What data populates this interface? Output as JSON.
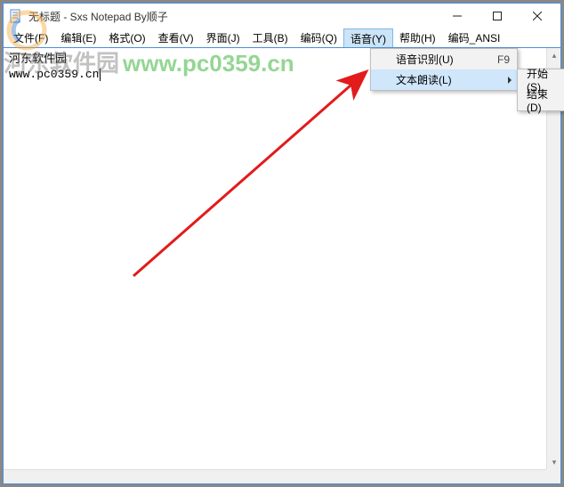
{
  "window": {
    "title": "无标题 - Sxs Notepad  By顺子"
  },
  "menubar": {
    "items": [
      "文件(F)",
      "编辑(E)",
      "格式(O)",
      "查看(V)",
      "界面(J)",
      "工具(B)",
      "编码(Q)",
      "语音(Y)",
      "帮助(H)",
      "编码_ANSI"
    ],
    "active_index": 7
  },
  "editor": {
    "line1": "河东软件园",
    "line2": "www.pc0359.cn"
  },
  "watermark": {
    "cn": "河东软件园",
    "url": "www.pc0359.cn"
  },
  "dropdown_main": {
    "items": [
      {
        "label": "语音识别(U)",
        "shortcut": "F9",
        "hovered": false,
        "has_sub": false
      },
      {
        "label": "文本朗读(L)",
        "shortcut": "",
        "hovered": true,
        "has_sub": true
      }
    ]
  },
  "dropdown_sub": {
    "items": [
      {
        "label": "开始(S)"
      },
      {
        "label": "结束(D)"
      }
    ]
  }
}
